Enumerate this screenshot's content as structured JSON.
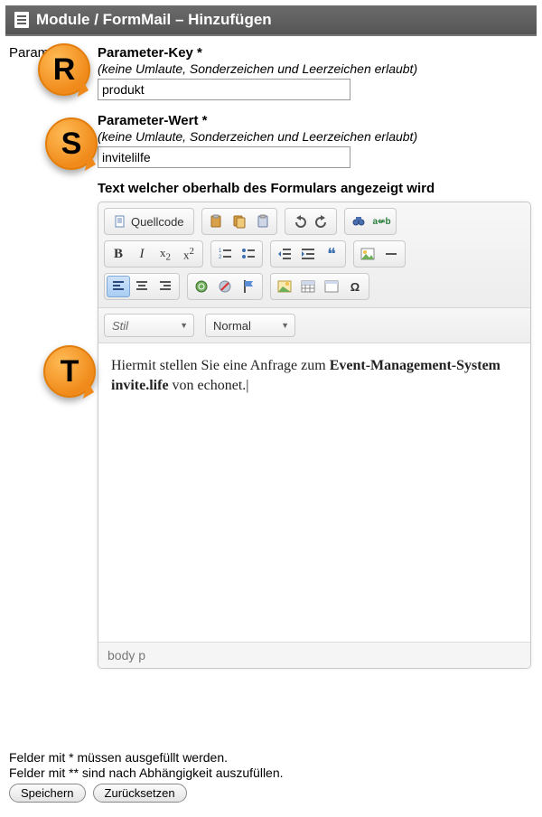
{
  "header": {
    "title": "Module / FormMail – Hinzufügen"
  },
  "sidebar": {
    "section_label": "Parameter"
  },
  "fields": {
    "key": {
      "label": "Parameter-Key *",
      "hint": "(keine Umlaute, Sonderzeichen und Leerzeichen erlaubt)",
      "value": "produkt"
    },
    "value": {
      "label": "Parameter-Wert *",
      "hint": "(keine Umlaute, Sonderzeichen und Leerzeichen erlaubt)",
      "value": "invitelilfe"
    },
    "text": {
      "label": "Text welcher oberhalb des Formulars angezeigt wird"
    }
  },
  "toolbar": {
    "source_label": "Quellcode"
  },
  "selects": {
    "style_label": "Stil",
    "format_label": "Normal"
  },
  "editor": {
    "content_plain_prefix": "Hiermit stellen Sie eine Anfrage zum ",
    "content_bold": "Event-Management-System invite.life",
    "content_plain_suffix": " von echonet.",
    "status_path": "body  p"
  },
  "footer": {
    "note1": "Felder mit * müssen ausgefüllt werden.",
    "note2": "Felder mit ** sind nach Abhängigkeit auszufüllen.",
    "save": "Speichern",
    "reset": "Zurücksetzen"
  },
  "annotations": {
    "r": "R",
    "s": "S",
    "t": "T"
  }
}
